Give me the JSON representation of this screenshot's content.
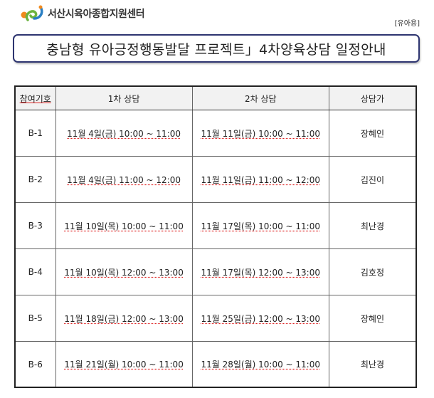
{
  "header": {
    "logo_text": "서산시육아종합지원센터",
    "tag": "[유아용]",
    "title": "충남형 유아긍정행동발달 프로젝트」4차양육상담 일정안내"
  },
  "table": {
    "headers": [
      "참여기호",
      "1차 상담",
      "2차 상담",
      "상담가"
    ],
    "rows": [
      [
        "B-1",
        "11월 4일(금) 10:00 ~ 11:00",
        "11월 11일(금) 10:00 ~ 11:00",
        "장혜인"
      ],
      [
        "B-2",
        "11월 4일(금) 11:00 ~ 12:00",
        "11월 11일(금) 11:00 ~ 12:00",
        "김진이"
      ],
      [
        "B-3",
        "11월 10일(목) 10:00 ~ 11:00",
        "11월 17일(목) 10:00 ~ 11:00",
        "최난경"
      ],
      [
        "B-4",
        "11월 10일(목) 12:00 ~ 13:00",
        "11월 17일(목) 12:00 ~ 13:00",
        "김호정"
      ],
      [
        "B-5",
        "11월 18일(금) 12:00 ~ 13:00",
        "11월 25일(금) 12:00 ~ 13:00",
        "장혜인"
      ],
      [
        "B-6",
        "11월 21일(월) 10:00 ~ 11:00",
        "11월 28일(월) 10:00 ~ 11:00",
        "최난경"
      ]
    ]
  },
  "colors": {
    "title_border": "#2e3570",
    "header_id": "#b01818",
    "logo_orange": "#f08a1e",
    "logo_green": "#6cb33f",
    "logo_blue": "#2a7fc4"
  }
}
